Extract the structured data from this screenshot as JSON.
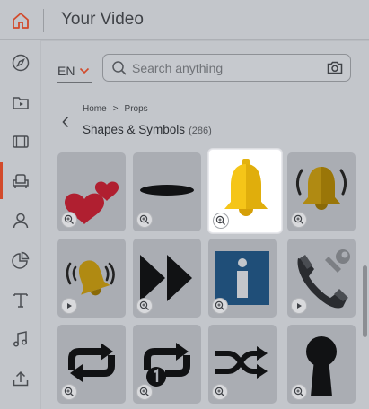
{
  "header": {
    "title": "Your Video",
    "home_icon": "home-icon"
  },
  "sidebar": {
    "items": [
      {
        "name": "compass-icon"
      },
      {
        "name": "media-folder-icon"
      },
      {
        "name": "film-icon"
      },
      {
        "name": "props-chair-icon",
        "active": true
      },
      {
        "name": "character-icon"
      },
      {
        "name": "chart-icon"
      },
      {
        "name": "text-icon"
      },
      {
        "name": "music-icon"
      },
      {
        "name": "upload-icon"
      }
    ]
  },
  "toolbar": {
    "language": "EN",
    "search_placeholder": "Search anything"
  },
  "breadcrumb": {
    "home": "Home",
    "separator": ">",
    "current": "Props"
  },
  "section": {
    "title": "Shapes & Symbols",
    "count": "(286)"
  },
  "tiles": [
    {
      "name": "hearts-tile",
      "badge": "zoom"
    },
    {
      "name": "black-hole-tile",
      "badge": "zoom"
    },
    {
      "name": "bell-tile",
      "badge": "zoom",
      "selected": true
    },
    {
      "name": "ringing-bell-tile",
      "badge": "zoom"
    },
    {
      "name": "animated-ringing-bell-tile",
      "badge": "play"
    },
    {
      "name": "fast-forward-tile",
      "badge": "zoom"
    },
    {
      "name": "info-tile",
      "badge": "zoom"
    },
    {
      "name": "phone-wrench-tile",
      "badge": "play"
    },
    {
      "name": "repeat-tile",
      "badge": "zoom"
    },
    {
      "name": "repeat-once-tile",
      "badge": "zoom"
    },
    {
      "name": "shuffle-tile",
      "badge": "zoom"
    },
    {
      "name": "keyhole-tile",
      "badge": "zoom"
    }
  ],
  "colors": {
    "accent": "#d24a2b",
    "bell_yellow": "#f5c518",
    "info_blue": "#2a5d8f",
    "heart_red": "#d8283a"
  }
}
